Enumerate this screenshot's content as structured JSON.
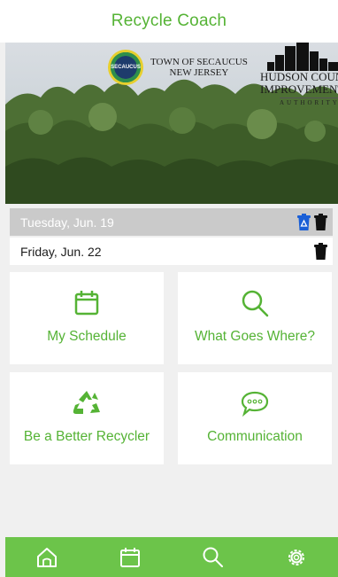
{
  "header": {
    "title": "Recycle Coach"
  },
  "hero": {
    "town_logo": {
      "seal_text": "SECAUCUS",
      "line1": "TOWN OF SECAUCUS",
      "line2": "NEW JERSEY"
    },
    "hcia_logo": {
      "line1": "HUDSON COUNTY",
      "line2": "IMPROVEMENT",
      "line3": "AUTHORITY"
    }
  },
  "pickups": [
    {
      "date": "Tuesday, Jun. 19",
      "icons": [
        "recycle-bin-icon",
        "trash-bin-icon"
      ]
    },
    {
      "date": "Friday, Jun. 22",
      "icons": [
        "trash-bin-icon"
      ]
    }
  ],
  "tiles": [
    {
      "label": "My Schedule",
      "icon": "calendar-icon"
    },
    {
      "label": "What Goes Where?",
      "icon": "magnifier-icon"
    },
    {
      "label": "Be a Better Recycler",
      "icon": "recycle-icon"
    },
    {
      "label": "Communication",
      "icon": "speech-bubble-icon"
    }
  ],
  "bottom_nav": [
    {
      "name": "home",
      "icon": "home-icon"
    },
    {
      "name": "schedule",
      "icon": "calendar-icon"
    },
    {
      "name": "search",
      "icon": "search-icon"
    },
    {
      "name": "settings",
      "icon": "gear-icon"
    }
  ],
  "colors": {
    "accent_green": "#55b335",
    "nav_green": "#6cc44a",
    "recycle_blue": "#1a5fd6",
    "current_row_gray": "#cacaca"
  }
}
